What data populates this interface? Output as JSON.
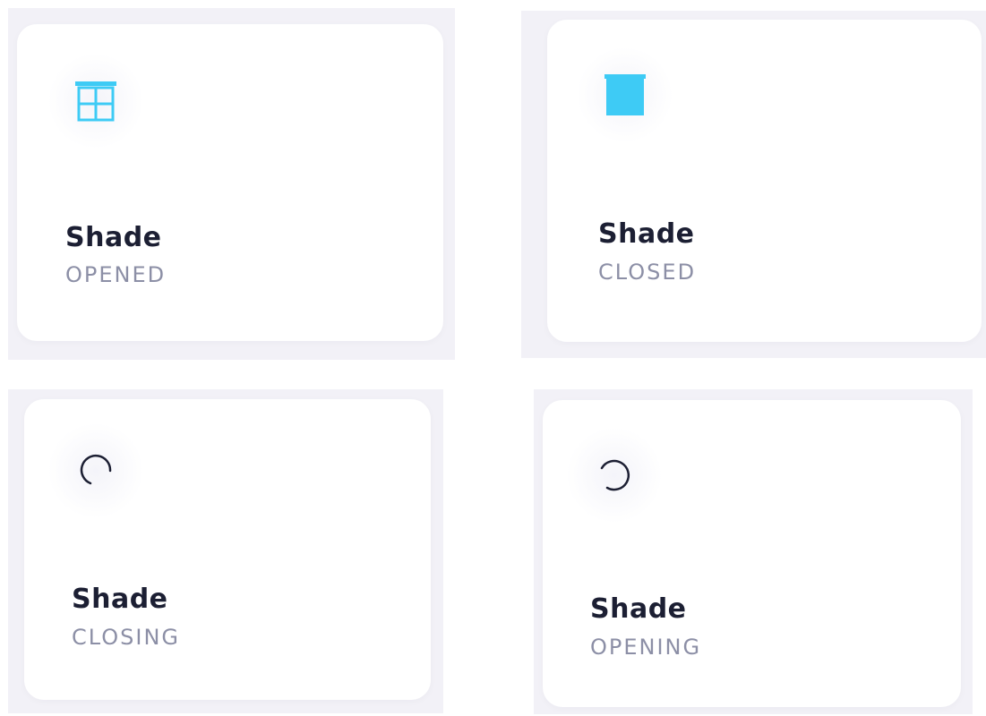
{
  "colors": {
    "accent": "#3ecbf5",
    "title": "#1c1f33",
    "status": "#8c8fa6",
    "panel_bg": "#f2f1f7",
    "card_bg": "#ffffff",
    "spinner": "#1c1f33"
  },
  "tiles": [
    {
      "title": "Shade",
      "status": "OPENED",
      "icon": "shade-open-icon"
    },
    {
      "title": "Shade",
      "status": "CLOSED",
      "icon": "shade-closed-icon"
    },
    {
      "title": "Shade",
      "status": "CLOSING",
      "icon": "spinner-icon"
    },
    {
      "title": "Shade",
      "status": "OPENING",
      "icon": "spinner-icon"
    }
  ]
}
